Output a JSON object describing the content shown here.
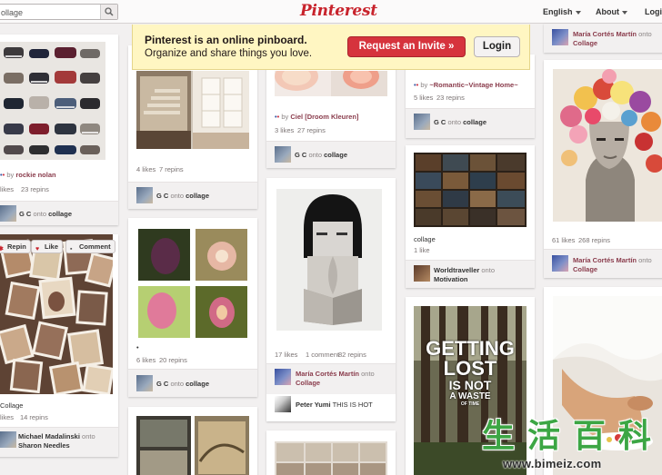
{
  "header": {
    "search_value": "ollage",
    "logo": "Pinterest",
    "nav": [
      "English",
      "About",
      "Logi"
    ]
  },
  "banner": {
    "title": "Pinterest is an online pinboard.",
    "subtitle": "Organize and share things you love.",
    "request_label": "Request an Invite »",
    "login_label": "Login"
  },
  "pins": {
    "shoes": {
      "via_prefix": "by",
      "via_user": "rockie nolan",
      "likes": "likes",
      "repins": "23 repins",
      "pinner": "G C",
      "onto": "onto",
      "board": "collage"
    },
    "polaroids": {
      "repin": "Repin",
      "like": "Like",
      "comment": "Comment",
      "desc": "Collage",
      "likes": "likes",
      "repins": "14 repins",
      "pinner": "Michael Madalinski",
      "onto": "onto",
      "board": "Sharon Needles"
    },
    "stairs": {
      "desc": "•",
      "likes": "4 likes",
      "repins": "7 repins",
      "pinner": "G C",
      "onto": "onto",
      "board": "collage"
    },
    "flowers": {
      "desc": "•",
      "likes": "6 likes",
      "repins": "20 repins",
      "pinner": "G C",
      "onto": "onto",
      "board": "collage"
    },
    "grapefruit": {
      "via_prefix": "by",
      "via_user": "Ciel [Droom Kleuren]",
      "likes": "3 likes",
      "repins": "27 repins",
      "pinner": "G C",
      "onto": "onto",
      "board": "collage"
    },
    "face": {
      "likes": "17 likes",
      "comments": "1 comment",
      "repins": "82 repins",
      "pinner": "María Cortés Martín",
      "onto": "onto",
      "board": "Collage",
      "commenter": "Peter Yumi",
      "comment": "THIS IS HOT"
    },
    "vintage": {
      "via_prefix": "by",
      "via_user": "~Romantic~Vintage Home~",
      "likes": "5 likes",
      "repins": "23 repins",
      "pinner": "G C",
      "onto": "onto",
      "board": "collage"
    },
    "film": {
      "desc": "collage",
      "likes": "1 like",
      "pinner": "Worldtraveller",
      "onto": "onto",
      "board": "Motivation"
    },
    "forest": {
      "line1": "GETTING",
      "line2": "LOST",
      "line3": "IS NOT",
      "line4": "A WASTE",
      "line5": "OF TIME"
    },
    "flowerhead": {
      "top_pinner": "María Cortés Martín",
      "top_onto": "onto",
      "top_board": "Collage",
      "likes": "61 likes",
      "repins": "268 repins",
      "pinner": "María Cortés Martín",
      "onto": "onto",
      "board": "Collage"
    }
  },
  "watermark": {
    "chars": [
      "生",
      "活",
      "百",
      "科"
    ],
    "url": "www.bimeiz.com"
  }
}
